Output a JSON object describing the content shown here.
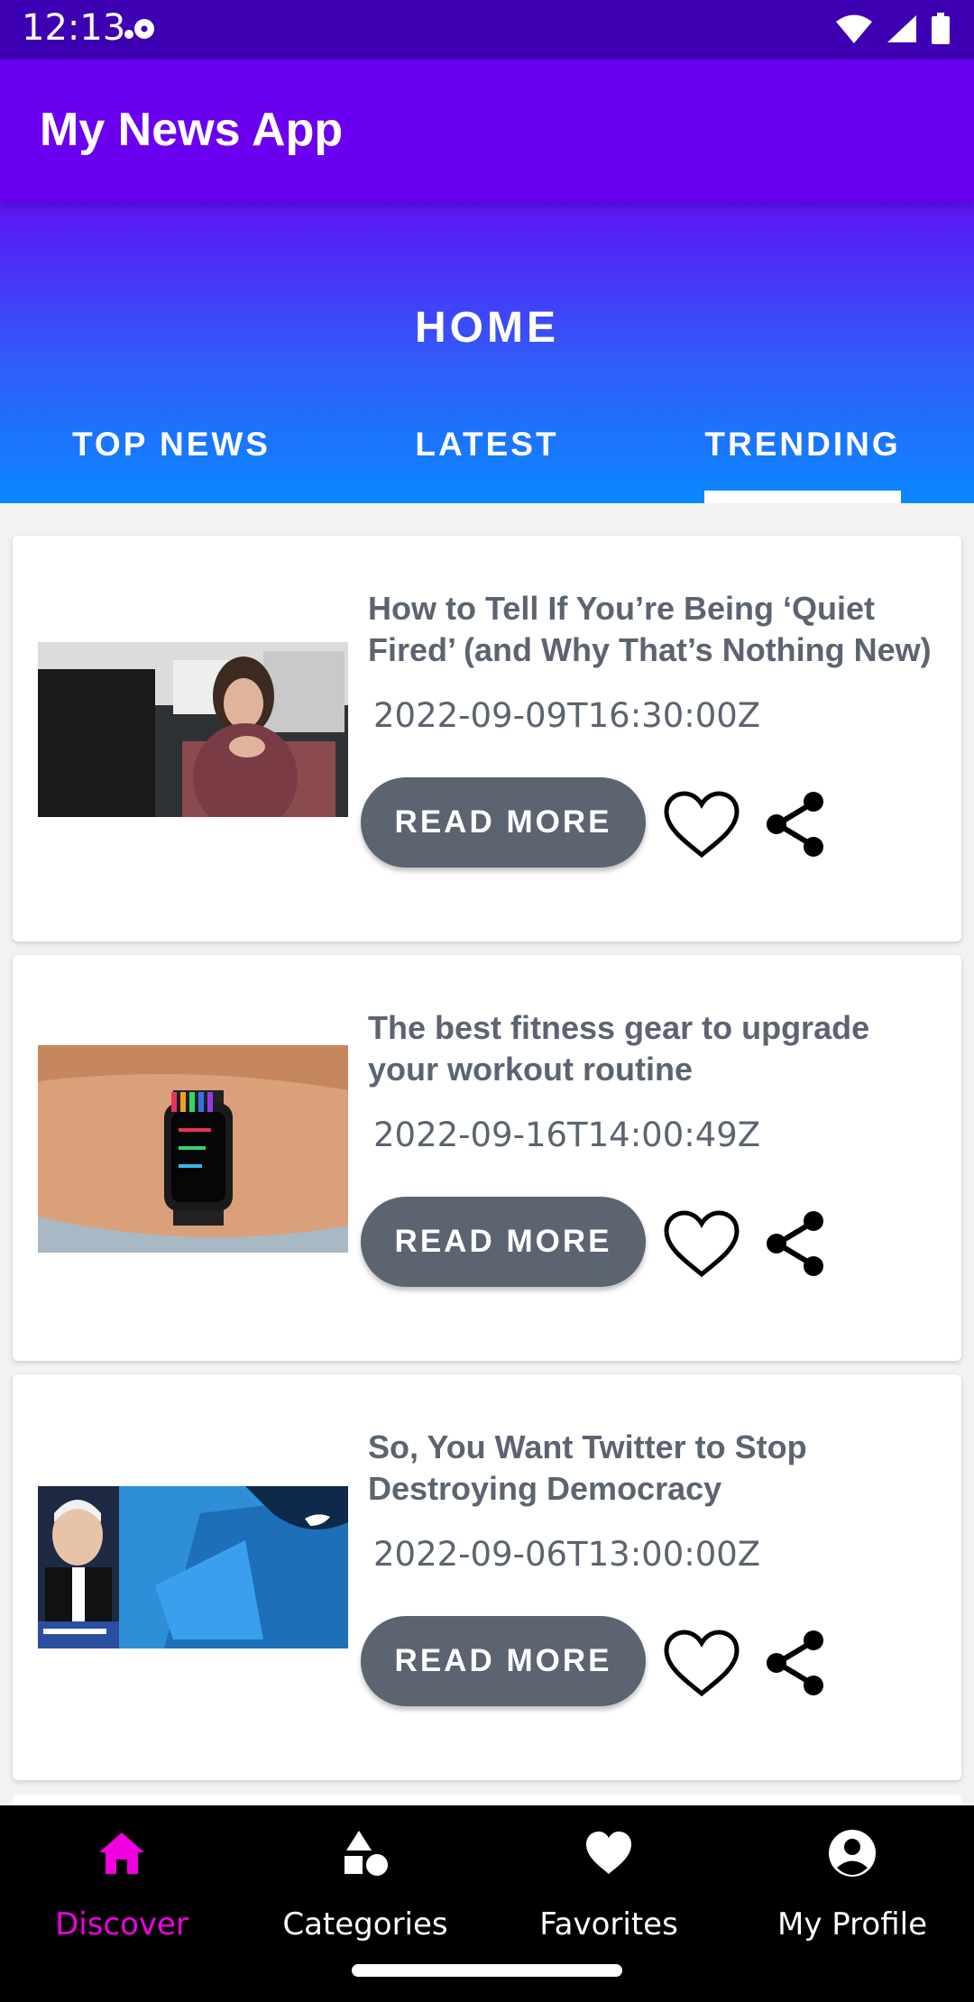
{
  "status_bar": {
    "time": "12:13"
  },
  "app_bar": {
    "title": "My News App"
  },
  "header": {
    "title": "HOME",
    "tabs": [
      {
        "label": "TOP NEWS",
        "selected": false
      },
      {
        "label": "LATEST",
        "selected": false
      },
      {
        "label": "TRENDING",
        "selected": true
      }
    ]
  },
  "articles": [
    {
      "title": "How to Tell If You’re Being ‘Quiet Fired’ (and Why That’s Nothing New)",
      "date": "2022-09-09T16:30:00Z",
      "read_more": "READ MORE"
    },
    {
      "title": "The best fitness gear to upgrade your workout routine",
      "date": "2022-09-16T14:00:49Z",
      "read_more": "READ MORE"
    },
    {
      "title": "So, You Want Twitter to Stop Destroying Democracy",
      "date": "2022-09-06T13:00:00Z",
      "read_more": "READ MORE"
    }
  ],
  "bottom_nav": [
    {
      "label": "Discover",
      "icon": "home-icon",
      "active": true
    },
    {
      "label": "Categories",
      "icon": "categories-icon",
      "active": false
    },
    {
      "label": "Favorites",
      "icon": "heart-icon",
      "active": false
    },
    {
      "label": "My Profile",
      "icon": "account-icon",
      "active": false
    }
  ],
  "colors": {
    "status_bar": "#3d00b3",
    "app_bar": "#6b00f0",
    "header_gradient_top": "#5d14f5",
    "header_gradient_bottom": "#0a88ff",
    "button": "#5b6470",
    "nav_active": "#f000e0"
  }
}
